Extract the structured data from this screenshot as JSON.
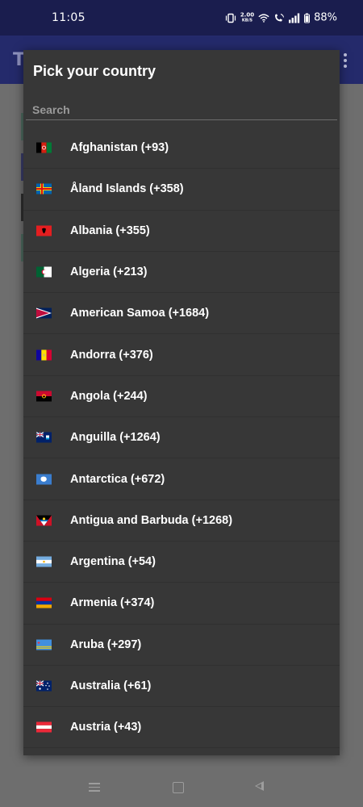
{
  "status_bar": {
    "time": "11:05",
    "net_speed_value": "2.00",
    "net_speed_unit": "KB/S",
    "battery": "88%",
    "icons": [
      "vibrate-icon",
      "wifi-icon",
      "wifi-call-icon",
      "signal-icon",
      "battery-icon"
    ]
  },
  "app_bar": {
    "title_fragment": "T",
    "menu_icon": "more-vertical-icon"
  },
  "dialog": {
    "title": "Pick your country",
    "search_placeholder": "Search",
    "countries": [
      {
        "label": "Afghanistan (+93)",
        "flag": "af"
      },
      {
        "label": "Åland Islands (+358)",
        "flag": "ax"
      },
      {
        "label": "Albania (+355)",
        "flag": "al"
      },
      {
        "label": "Algeria (+213)",
        "flag": "dz"
      },
      {
        "label": "American Samoa (+1684)",
        "flag": "as"
      },
      {
        "label": "Andorra (+376)",
        "flag": "ad"
      },
      {
        "label": "Angola (+244)",
        "flag": "ao"
      },
      {
        "label": "Anguilla (+1264)",
        "flag": "ai"
      },
      {
        "label": "Antarctica (+672)",
        "flag": "aq"
      },
      {
        "label": "Antigua and Barbuda (+1268)",
        "flag": "ag"
      },
      {
        "label": "Argentina (+54)",
        "flag": "ar"
      },
      {
        "label": "Armenia (+374)",
        "flag": "am"
      },
      {
        "label": "Aruba (+297)",
        "flag": "aw"
      },
      {
        "label": "Australia (+61)",
        "flag": "au"
      },
      {
        "label": "Austria (+43)",
        "flag": "at"
      }
    ]
  },
  "nav_bar": {
    "icons": [
      "recent-apps-icon",
      "home-icon",
      "back-icon"
    ]
  }
}
